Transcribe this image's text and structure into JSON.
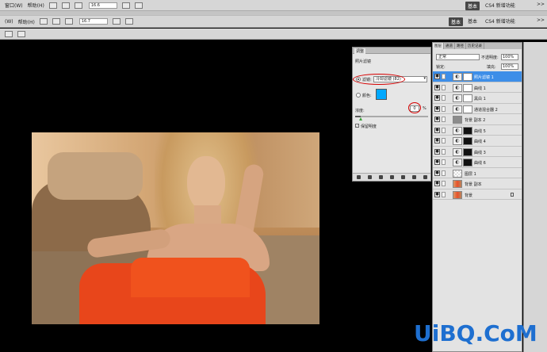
{
  "menubar": {
    "window_label": "窗口(W)",
    "help_label": "帮助(H)",
    "zoom": "16.6",
    "workspaces": [
      "基本",
      "CS4 新增功能"
    ],
    "active_workspace": "基本",
    "chevron": ">>"
  },
  "menubar2": {
    "window_label": "(W)",
    "help_label": "帮助(H)",
    "zoom": "16.7",
    "workspaces": [
      "基本",
      "CS4 新增功能"
    ],
    "active_workspace": "基本",
    "chevron": ">>"
  },
  "adjustments": {
    "tab_label": "调整",
    "panel_title": "照片滤镜",
    "filter_label": "滤镜:",
    "filter_value": "冷却滤镜 (82)",
    "color_label": "颜色:",
    "color_swatch": "#00a8ff",
    "density_label": "浓度:",
    "density_value": "0",
    "density_unit": "%",
    "density_fraction": 0.08,
    "preserve_luminosity_label": "保留明度",
    "preserve_luminosity_checked": true,
    "highlight_color": "#d60000"
  },
  "layers": {
    "tabs": [
      "图层",
      "通道",
      "路径",
      "历史记录"
    ],
    "active_tab": "图层",
    "blend_mode": "正常",
    "opacity_label": "不透明度:",
    "opacity_value": "100%",
    "lock_label": "锁定:",
    "fill_label": "填充:",
    "fill_value": "100%",
    "items": [
      {
        "name": "照片滤镜 1",
        "thumb": "adj",
        "mask": "white",
        "selected": true
      },
      {
        "name": "曲线 1",
        "thumb": "adj",
        "mask": "white",
        "selected": false
      },
      {
        "name": "黑白 1",
        "thumb": "adj",
        "mask": "white",
        "selected": false
      },
      {
        "name": "通道混合器 2",
        "thumb": "adj",
        "mask": "white",
        "selected": false
      },
      {
        "name": "背景 副本 2",
        "thumb": "gray",
        "mask": "none",
        "selected": false
      },
      {
        "name": "曲线 5",
        "thumb": "adj",
        "mask": "dark",
        "selected": false
      },
      {
        "name": "曲线 4",
        "thumb": "adj",
        "mask": "dark",
        "selected": false
      },
      {
        "name": "曲线 3",
        "thumb": "adj",
        "mask": "dark",
        "selected": false
      },
      {
        "name": "曲线 6",
        "thumb": "adj",
        "mask": "dark",
        "selected": false
      },
      {
        "name": "图层 1",
        "thumb": "check",
        "mask": "none",
        "selected": false
      },
      {
        "name": "背景 副本",
        "thumb": "photo",
        "mask": "none",
        "selected": false
      },
      {
        "name": "背景",
        "thumb": "photo",
        "mask": "none",
        "selected": false
      }
    ],
    "selection_color": "#3d8ee8"
  },
  "watermark": {
    "text": "UiBQ.CoM",
    "color": "#1e6fd0"
  }
}
